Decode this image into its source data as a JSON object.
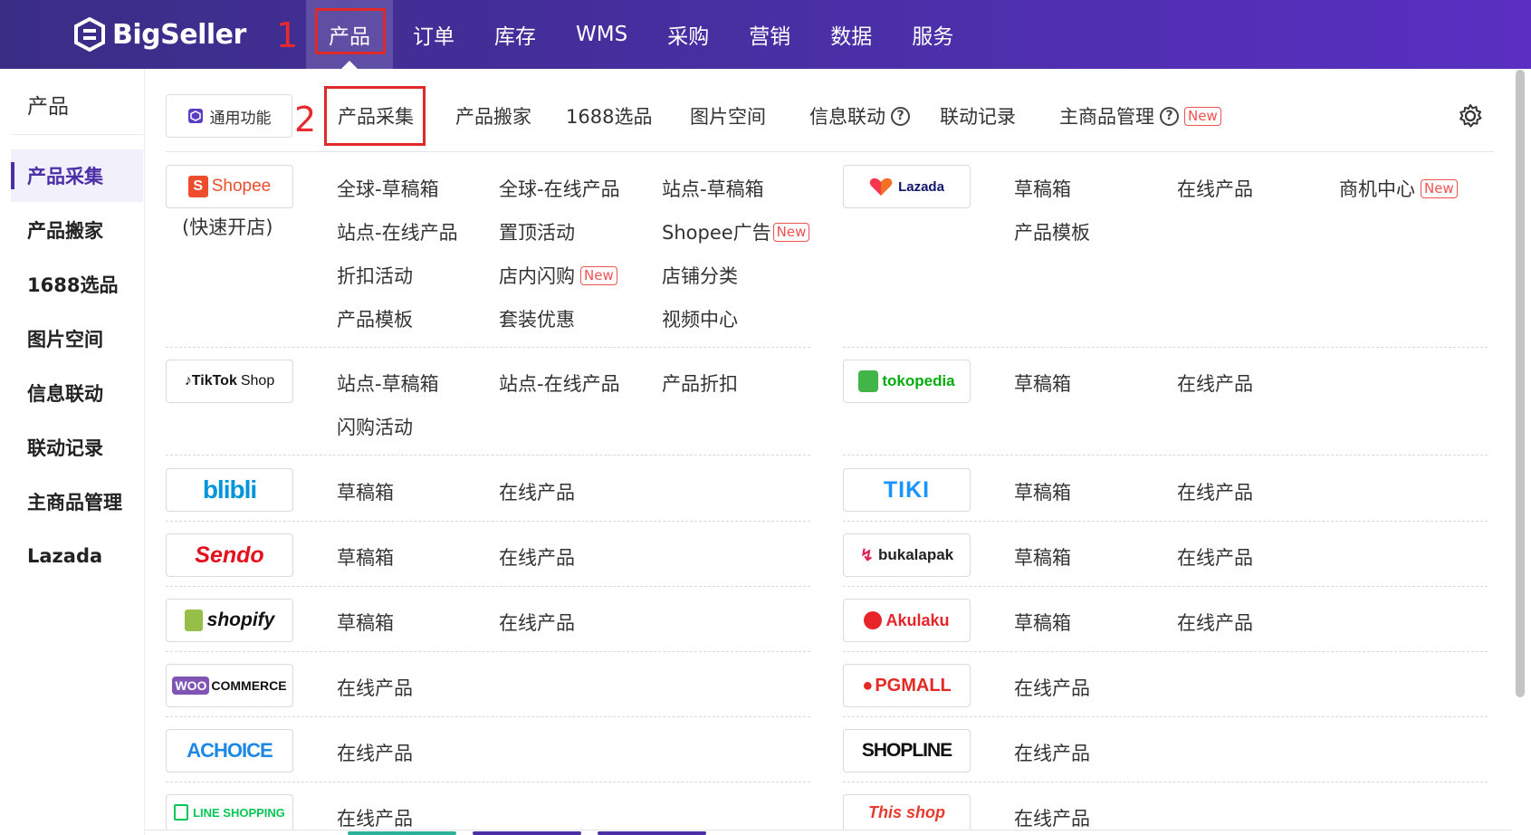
{
  "brand": {
    "name": "BigSeller"
  },
  "steps": {
    "one": "1",
    "two": "2"
  },
  "nav": [
    {
      "label": "产品"
    },
    {
      "label": "订单"
    },
    {
      "label": "库存"
    },
    {
      "label": "WMS"
    },
    {
      "label": "采购"
    },
    {
      "label": "营销"
    },
    {
      "label": "数据"
    },
    {
      "label": "服务"
    }
  ],
  "sidebar": {
    "title": "产品",
    "items": [
      {
        "label": "产品采集"
      },
      {
        "label": "产品搬家"
      },
      {
        "label": "1688选品"
      },
      {
        "label": "图片空间"
      },
      {
        "label": "信息联动"
      },
      {
        "label": "联动记录"
      },
      {
        "label": "主商品管理"
      },
      {
        "label": "Lazada"
      }
    ]
  },
  "subtabs": {
    "general": "通用功能",
    "items": [
      {
        "label": "产品采集"
      },
      {
        "label": "产品搬家"
      },
      {
        "label": "1688选品"
      },
      {
        "label": "图片空间"
      },
      {
        "label": "信息联动"
      },
      {
        "label": "联动记录"
      },
      {
        "label": "主商品管理"
      }
    ],
    "new_badge": "New",
    "help_glyph": "?"
  },
  "platforms": {
    "shopee": {
      "name": "Shopee",
      "sub": "(快速开店)",
      "links": [
        "全球-草稿箱",
        "全球-在线产品",
        "站点-草稿箱",
        "站点-在线产品",
        "置顶活动",
        "Shopee广告",
        "折扣活动",
        "店内闪购",
        "店铺分类",
        "产品模板",
        "套装优惠",
        "视频中心"
      ]
    },
    "lazada": {
      "name": "Lazada",
      "links": [
        "草稿箱",
        "在线产品",
        "商机中心",
        "产品模板"
      ]
    },
    "tiktok": {
      "name": "TikTok",
      "name2": "Shop",
      "links": [
        "站点-草稿箱",
        "站点-在线产品",
        "产品折扣",
        "闪购活动"
      ]
    },
    "tokopedia": {
      "name": "tokopedia",
      "links": [
        "草稿箱",
        "在线产品"
      ]
    },
    "blibli": {
      "name": "blibli",
      "links": [
        "草稿箱",
        "在线产品"
      ]
    },
    "tiki": {
      "name": "TIKI",
      "links": [
        "草稿箱",
        "在线产品"
      ]
    },
    "sendo": {
      "name": "Sendo",
      "links": [
        "草稿箱",
        "在线产品"
      ]
    },
    "bukalapak": {
      "name": "bukalapak",
      "links": [
        "草稿箱",
        "在线产品"
      ]
    },
    "shopify": {
      "name": "shopify",
      "links": [
        "草稿箱",
        "在线产品"
      ]
    },
    "akulaku": {
      "name": "Akulaku",
      "links": [
        "草稿箱",
        "在线产品"
      ]
    },
    "woocommerce": {
      "name1": "WOO",
      "name2": "COMMERCE",
      "links": [
        "在线产品"
      ]
    },
    "pgmall": {
      "name": "PGMALL",
      "links": [
        "在线产品"
      ]
    },
    "achoice": {
      "name": "ACHOICE",
      "links": [
        "在线产品"
      ]
    },
    "shopline": {
      "name": "SHOPLINE",
      "links": [
        "在线产品"
      ]
    },
    "lineshopping": {
      "name": "LINE SHOPPING",
      "links": [
        "在线产品"
      ]
    },
    "thisshop": {
      "name": "This shop",
      "links": [
        "在线产品"
      ]
    }
  },
  "colors": {
    "nav_bg": "#4a2fa6",
    "accent": "#4a2fa6",
    "annotation_red": "#e02a2a",
    "new_badge": "#f05252"
  }
}
